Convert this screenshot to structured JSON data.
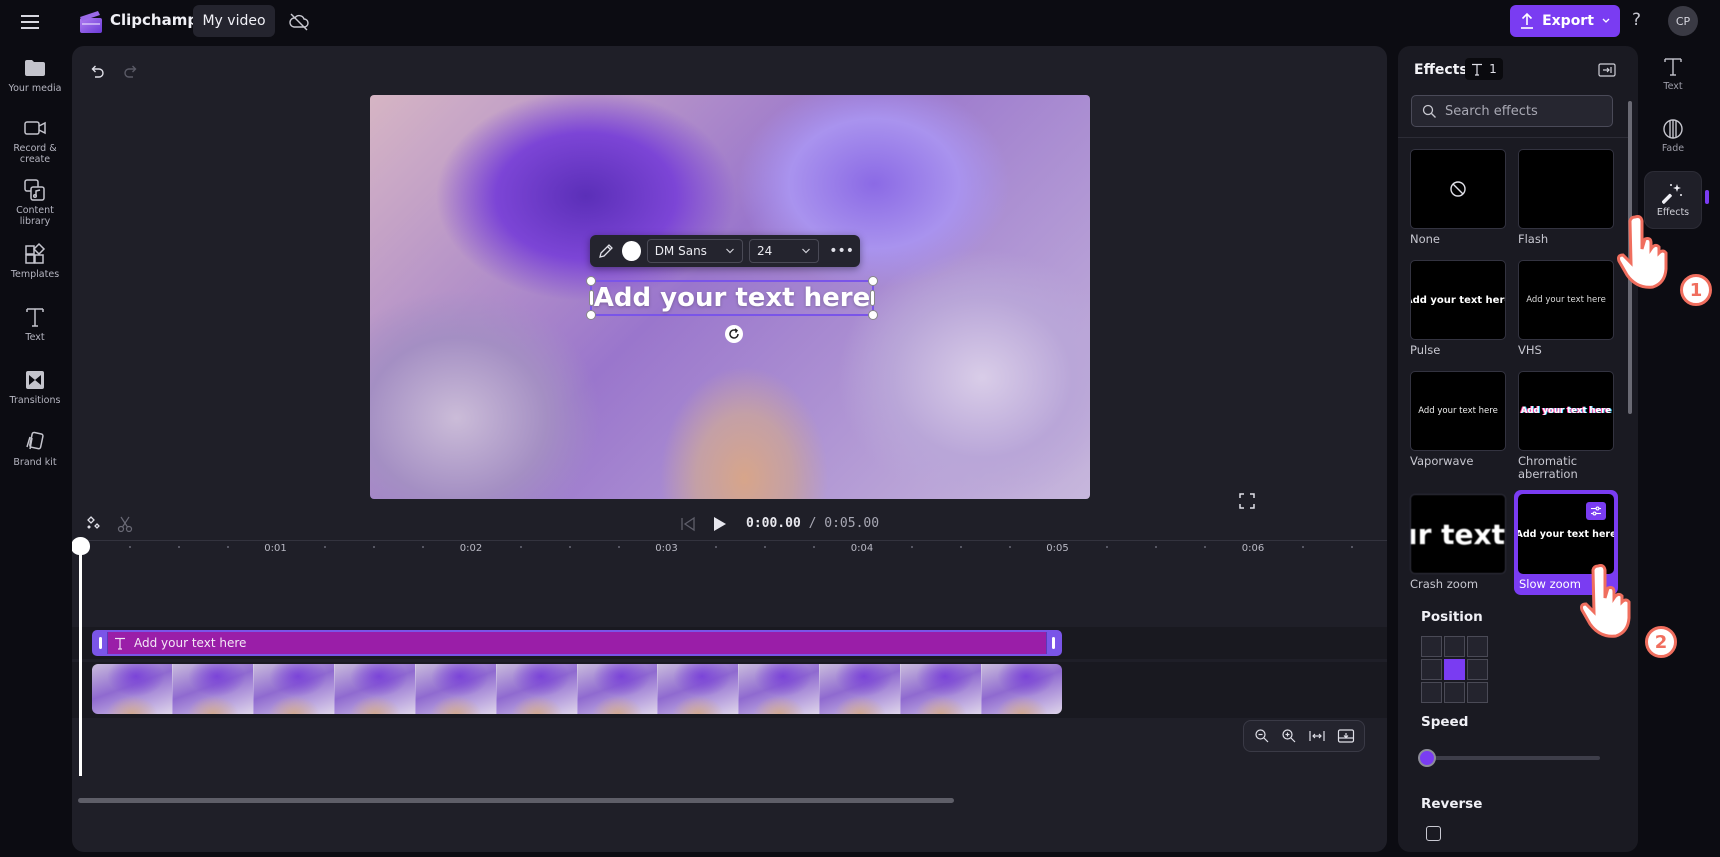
{
  "app": {
    "brand": "Clipchamp",
    "project_title": "My video",
    "export_label": "Export",
    "help_label": "?",
    "avatar_initials": "CP",
    "accent_color": "#7a3cf2"
  },
  "left_nav": {
    "items": [
      {
        "label": "Your media",
        "icon": "folder-icon"
      },
      {
        "label": "Record & create",
        "icon": "camera-icon"
      },
      {
        "label": "Content library",
        "icon": "content-library-icon"
      },
      {
        "label": "Templates",
        "icon": "templates-icon"
      },
      {
        "label": "Text",
        "icon": "text-icon"
      },
      {
        "label": "Transitions",
        "icon": "transitions-icon"
      },
      {
        "label": "Brand kit",
        "icon": "brand-kit-icon"
      }
    ]
  },
  "preview": {
    "text_toolbar": {
      "font": "DM Sans",
      "size": "24",
      "color": "#ffffff"
    },
    "overlay_text": "Add your text here"
  },
  "timeline": {
    "current_time": "0:00.00",
    "separator": "/",
    "total_time": "0:05.00",
    "ruler_labels": [
      "0:01",
      "0:02",
      "0:03",
      "0:04",
      "0:05",
      "0:06"
    ],
    "text_clip_label": "Add your text here"
  },
  "effects_panel": {
    "title": "Effects",
    "badge_count": "1",
    "search_placeholder": "Search effects",
    "effects": [
      {
        "name": "None",
        "preview": ""
      },
      {
        "name": "Flash",
        "preview": ""
      },
      {
        "name": "Pulse",
        "preview": "Add your text here"
      },
      {
        "name": "VHS",
        "preview": "Add your text here"
      },
      {
        "name": "Vaporwave",
        "preview": "Add your text here"
      },
      {
        "name": "Chromatic aberration",
        "preview": "Add your text here"
      },
      {
        "name": "Crash zoom",
        "preview": "your text"
      },
      {
        "name": "Slow zoom",
        "preview": "Add your text here",
        "selected": true
      }
    ],
    "position_label": "Position",
    "position_selected": "center",
    "speed_label": "Speed",
    "speed_value": 0,
    "reverse_label": "Reverse",
    "reverse_checked": false
  },
  "right_tabs": {
    "items": [
      {
        "label": "Text",
        "icon": "text-icon"
      },
      {
        "label": "Fade",
        "icon": "fade-icon"
      },
      {
        "label": "Effects",
        "icon": "magic-wand-icon",
        "active": true
      }
    ]
  },
  "annotations": {
    "step1": "1",
    "step2": "2"
  }
}
